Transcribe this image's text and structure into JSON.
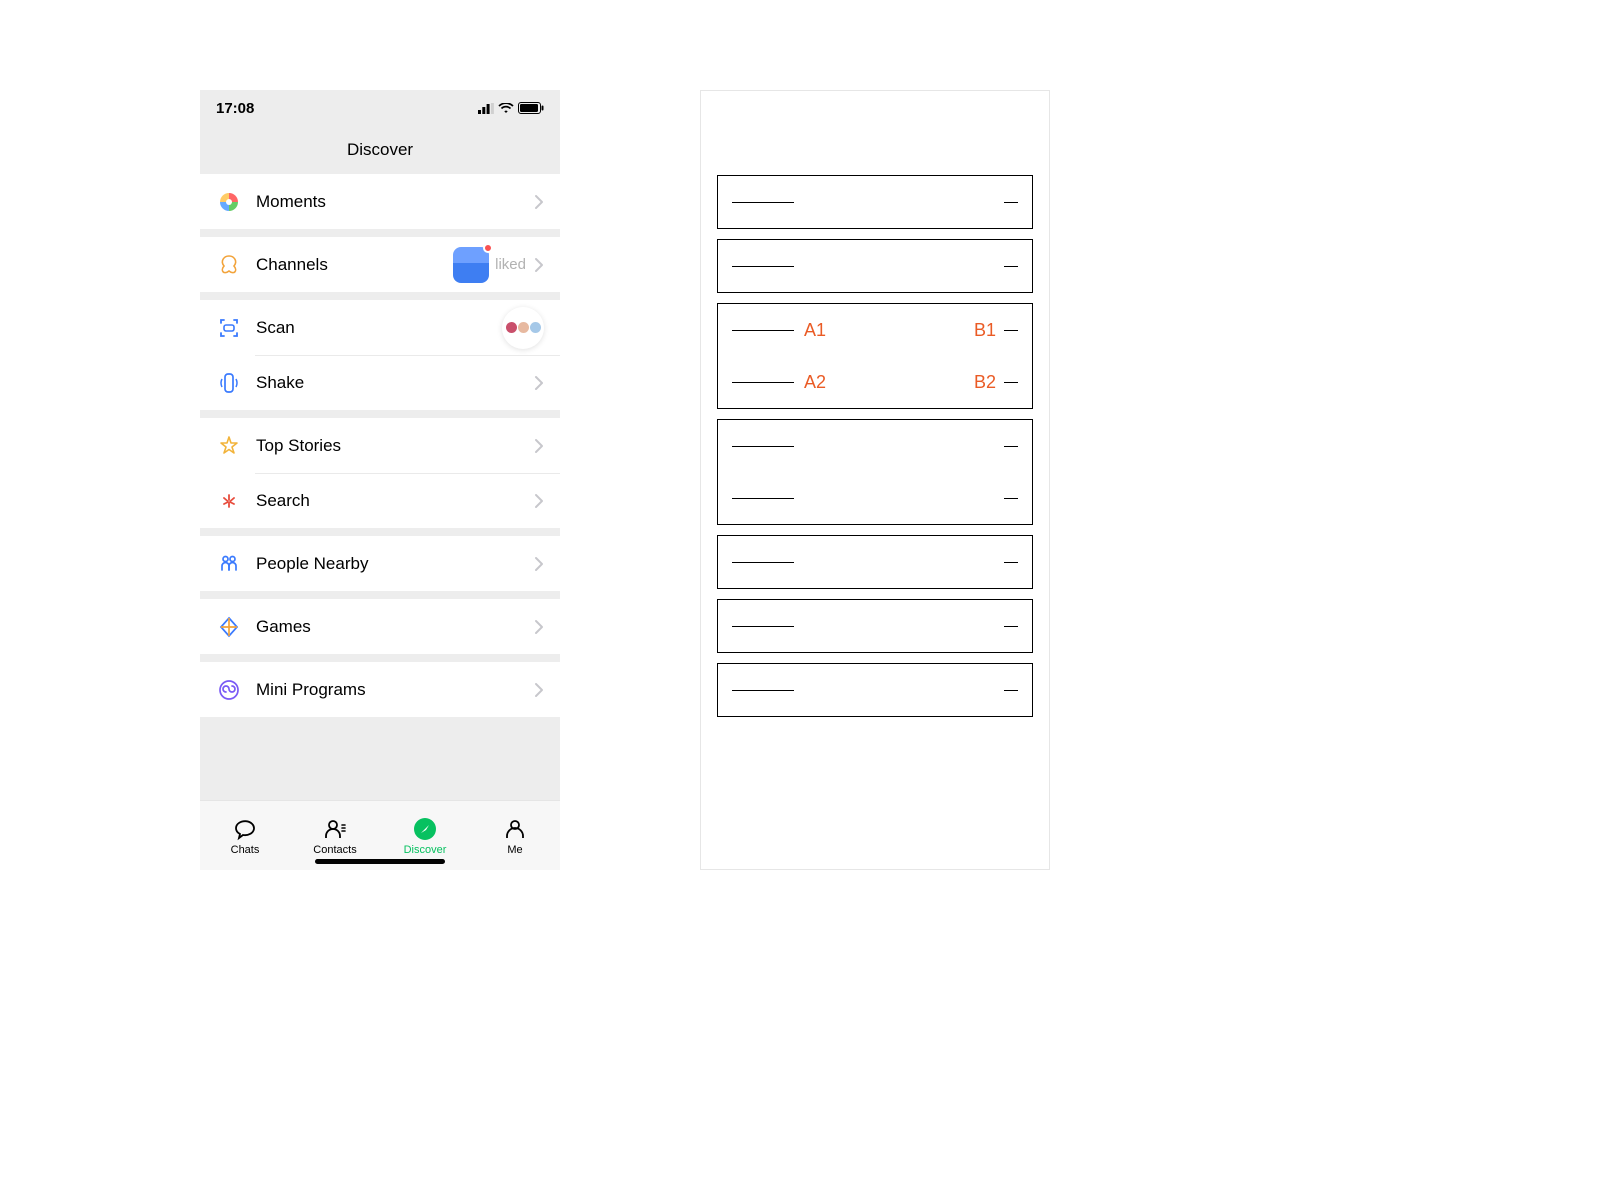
{
  "status": {
    "time": "17:08"
  },
  "title": "Discover",
  "groups": [
    [
      {
        "id": "moments",
        "label": "Moments",
        "kind": "plain"
      }
    ],
    [
      {
        "id": "channels",
        "label": "Channels",
        "kind": "channels",
        "extra": "liked"
      }
    ],
    [
      {
        "id": "scan",
        "label": "Scan",
        "kind": "scan"
      },
      {
        "id": "shake",
        "label": "Shake",
        "kind": "plain"
      }
    ],
    [
      {
        "id": "topstories",
        "label": "Top Stories",
        "kind": "plain"
      },
      {
        "id": "search",
        "label": "Search",
        "kind": "plain"
      }
    ],
    [
      {
        "id": "people-nearby",
        "label": "People Nearby",
        "kind": "plain"
      }
    ],
    [
      {
        "id": "games",
        "label": "Games",
        "kind": "plain"
      }
    ],
    [
      {
        "id": "mini-programs",
        "label": "Mini Programs",
        "kind": "plain"
      }
    ]
  ],
  "tabs": [
    {
      "id": "chats",
      "label": "Chats"
    },
    {
      "id": "contacts",
      "label": "Contacts"
    },
    {
      "id": "discover",
      "label": "Discover",
      "active": true
    },
    {
      "id": "me",
      "label": "Me"
    }
  ],
  "wire": {
    "annotations": {
      "A1": "A1",
      "A2": "A2",
      "B1": "B1",
      "B2": "B2"
    },
    "groups": [
      [
        {}
      ],
      [
        {}
      ],
      [
        {
          "a": "A1",
          "b": "B1"
        },
        {
          "a": "A2",
          "b": "B2"
        }
      ],
      [
        {},
        {}
      ],
      [
        {}
      ],
      [
        {}
      ],
      [
        {}
      ]
    ]
  }
}
